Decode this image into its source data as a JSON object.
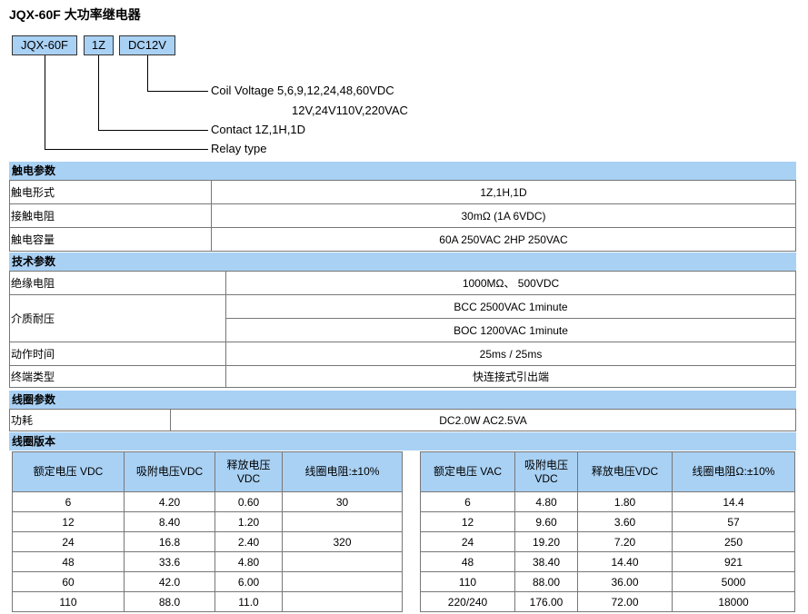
{
  "title": "JQX-60F 大功率继电器",
  "code": {
    "boxes": [
      "JQX-60F",
      "1Z",
      "DC12V"
    ],
    "coil_voltage_line1": "Coil Voltage 5,6,9,12,24,48,60VDC",
    "coil_voltage_line2": "12V,24V110V,220VAC",
    "contact": "Contact  1Z,1H,1D",
    "relay_type": "Relay type"
  },
  "contact_params": {
    "header": "触电参数",
    "rows": [
      {
        "label": "触电形式",
        "value": "1Z,1H,1D"
      },
      {
        "label": "接触电阻",
        "value": "30mΩ (1A 6VDC)"
      },
      {
        "label": "触电容量",
        "value": "60A 250VAC 2HP 250VAC"
      }
    ]
  },
  "tech_params": {
    "header": "技术参数",
    "insulation": {
      "label": "绝缘电阻",
      "value": "1000MΩ、 500VDC"
    },
    "dielectric": {
      "label": "介质耐压",
      "value1": "BCC 2500VAC 1minute",
      "value2": "BOC 1200VAC 1minute"
    },
    "action_time": {
      "label": "动作时间",
      "value": "25ms / 25ms"
    },
    "terminal": {
      "label": "终端类型",
      "value": "快连接式引出端"
    }
  },
  "coil_params": {
    "header": "线圈参数",
    "power": {
      "label": "功耗",
      "value": "DC2.0W AC2.5VA"
    }
  },
  "coil_version": {
    "header": "线圈版本",
    "dc": {
      "headers": [
        "额定电压 VDC",
        "吸附电压VDC",
        "释放电压VDC",
        "线圈电阻:±10%"
      ],
      "rows": [
        [
          "6",
          "4.20",
          "0.60",
          "30"
        ],
        [
          "12",
          "8.40",
          "1.20",
          ""
        ],
        [
          "24",
          "16.8",
          "2.40",
          "320"
        ],
        [
          "48",
          "33.6",
          "4.80",
          ""
        ],
        [
          "60",
          "42.0",
          "6.00",
          ""
        ],
        [
          "110",
          "88.0",
          "11.0",
          ""
        ]
      ]
    },
    "ac": {
      "headers": [
        "额定电压 VAC",
        "吸附电压VDC",
        "释放电压VDC",
        "线圈电阻Ω:±10%"
      ],
      "rows": [
        [
          "6",
          "4.80",
          "1.80",
          "14.4"
        ],
        [
          "12",
          "9.60",
          "3.60",
          "57"
        ],
        [
          "24",
          "19.20",
          "7.20",
          "250"
        ],
        [
          "48",
          "38.40",
          "14.40",
          "921"
        ],
        [
          "110",
          "88.00",
          "36.00",
          "5000"
        ],
        [
          "220/240",
          "176.00",
          "72.00",
          "18000"
        ]
      ]
    }
  }
}
